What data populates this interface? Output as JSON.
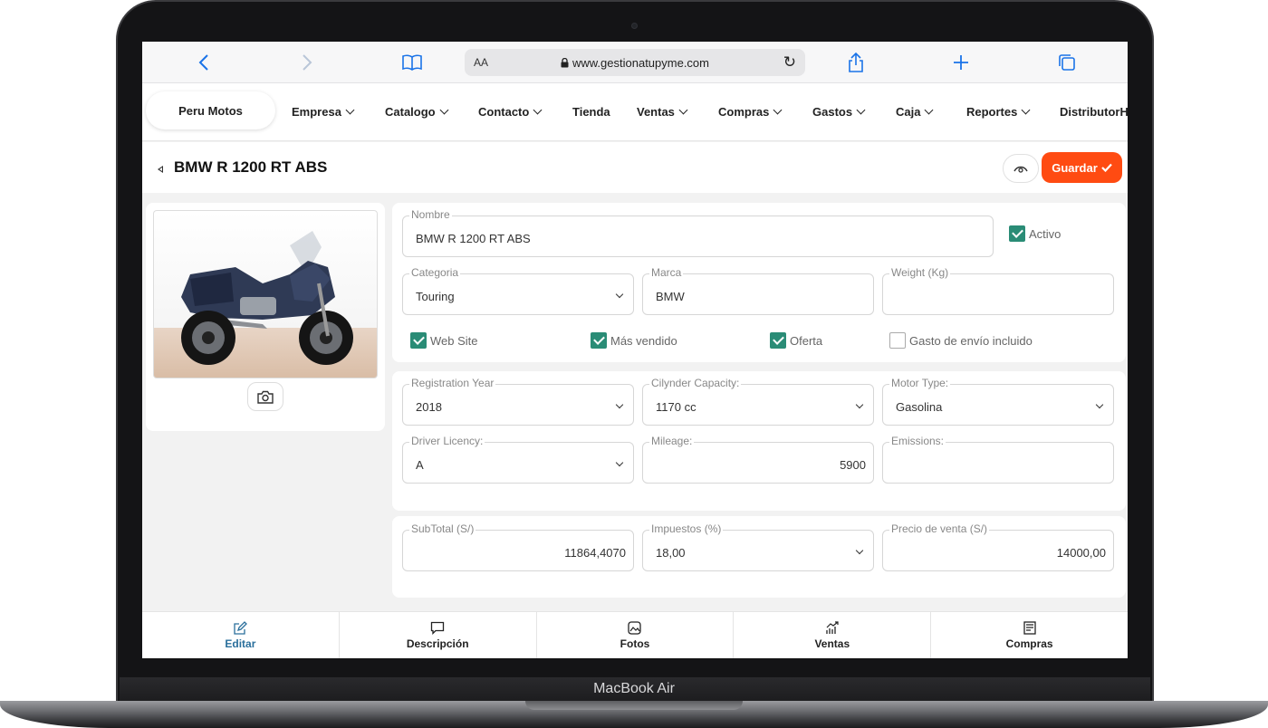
{
  "device": {
    "label": "MacBook Air"
  },
  "browser": {
    "url": "www.gestionatupyme.com",
    "reader_label": "AA",
    "icons": [
      "back-icon",
      "forward-icon",
      "bookmarks-icon",
      "lock-icon",
      "reload-icon",
      "share-icon",
      "new-tab-icon",
      "tabs-icon"
    ]
  },
  "nav": {
    "brand": "Peru Motos",
    "items": [
      {
        "label": "Empresa",
        "dropdown": true
      },
      {
        "label": "Catalogo",
        "dropdown": true
      },
      {
        "label": "Contacto",
        "dropdown": true
      },
      {
        "label": "Tienda",
        "dropdown": false
      },
      {
        "label": "Ventas",
        "dropdown": true
      },
      {
        "label": "Compras",
        "dropdown": true
      },
      {
        "label": "Gastos",
        "dropdown": true
      },
      {
        "label": "Caja",
        "dropdown": true
      },
      {
        "label": "Reportes",
        "dropdown": true
      },
      {
        "label": "DistributorHo",
        "dropdown": false
      }
    ]
  },
  "page": {
    "title": "BMW R 1200 RT ABS",
    "save_label": "Guardar"
  },
  "form": {
    "nombre": {
      "label": "Nombre",
      "value": "BMW R 1200 RT ABS"
    },
    "activo": {
      "label": "Activo",
      "checked": true
    },
    "categoria": {
      "label": "Categoria",
      "value": "Touring"
    },
    "marca": {
      "label": "Marca",
      "value": "BMW"
    },
    "weight": {
      "label": "Weight (Kg)",
      "value": ""
    },
    "checks": [
      {
        "label": "Web Site",
        "checked": true
      },
      {
        "label": "Más vendido",
        "checked": true
      },
      {
        "label": "Oferta",
        "checked": true
      },
      {
        "label": "Gasto de envío incluido",
        "checked": false
      }
    ],
    "registration_year": {
      "label": "Registration Year",
      "value": "2018"
    },
    "cylinder": {
      "label": "Cilynder Capacity:",
      "value": "1170 cc"
    },
    "motor_type": {
      "label": "Motor Type:",
      "value": "Gasolina"
    },
    "driver_licency": {
      "label": "Driver Licency:",
      "value": "A"
    },
    "mileage": {
      "label": "Mileage:",
      "value": "5900"
    },
    "emissions": {
      "label": "Emissions:",
      "value": ""
    },
    "subtotal": {
      "label": "SubTotal (S/)",
      "value": "11864,4070"
    },
    "impuestos": {
      "label": "Impuestos (%)",
      "value": "18,00"
    },
    "precio": {
      "label": "Precio de venta (S/)",
      "value": "14000,00"
    }
  },
  "tabs": [
    {
      "label": "Editar",
      "icon": "edit-icon",
      "active": true
    },
    {
      "label": "Descripción",
      "icon": "comment-icon",
      "active": false
    },
    {
      "label": "Fotos",
      "icon": "photo-icon",
      "active": false
    },
    {
      "label": "Ventas",
      "icon": "chart-icon",
      "active": false
    },
    {
      "label": "Compras",
      "icon": "receipt-icon",
      "active": false
    }
  ],
  "colors": {
    "accent": "#ff4b12",
    "check": "#2a8c76",
    "active_tab": "#2a6f9c"
  }
}
